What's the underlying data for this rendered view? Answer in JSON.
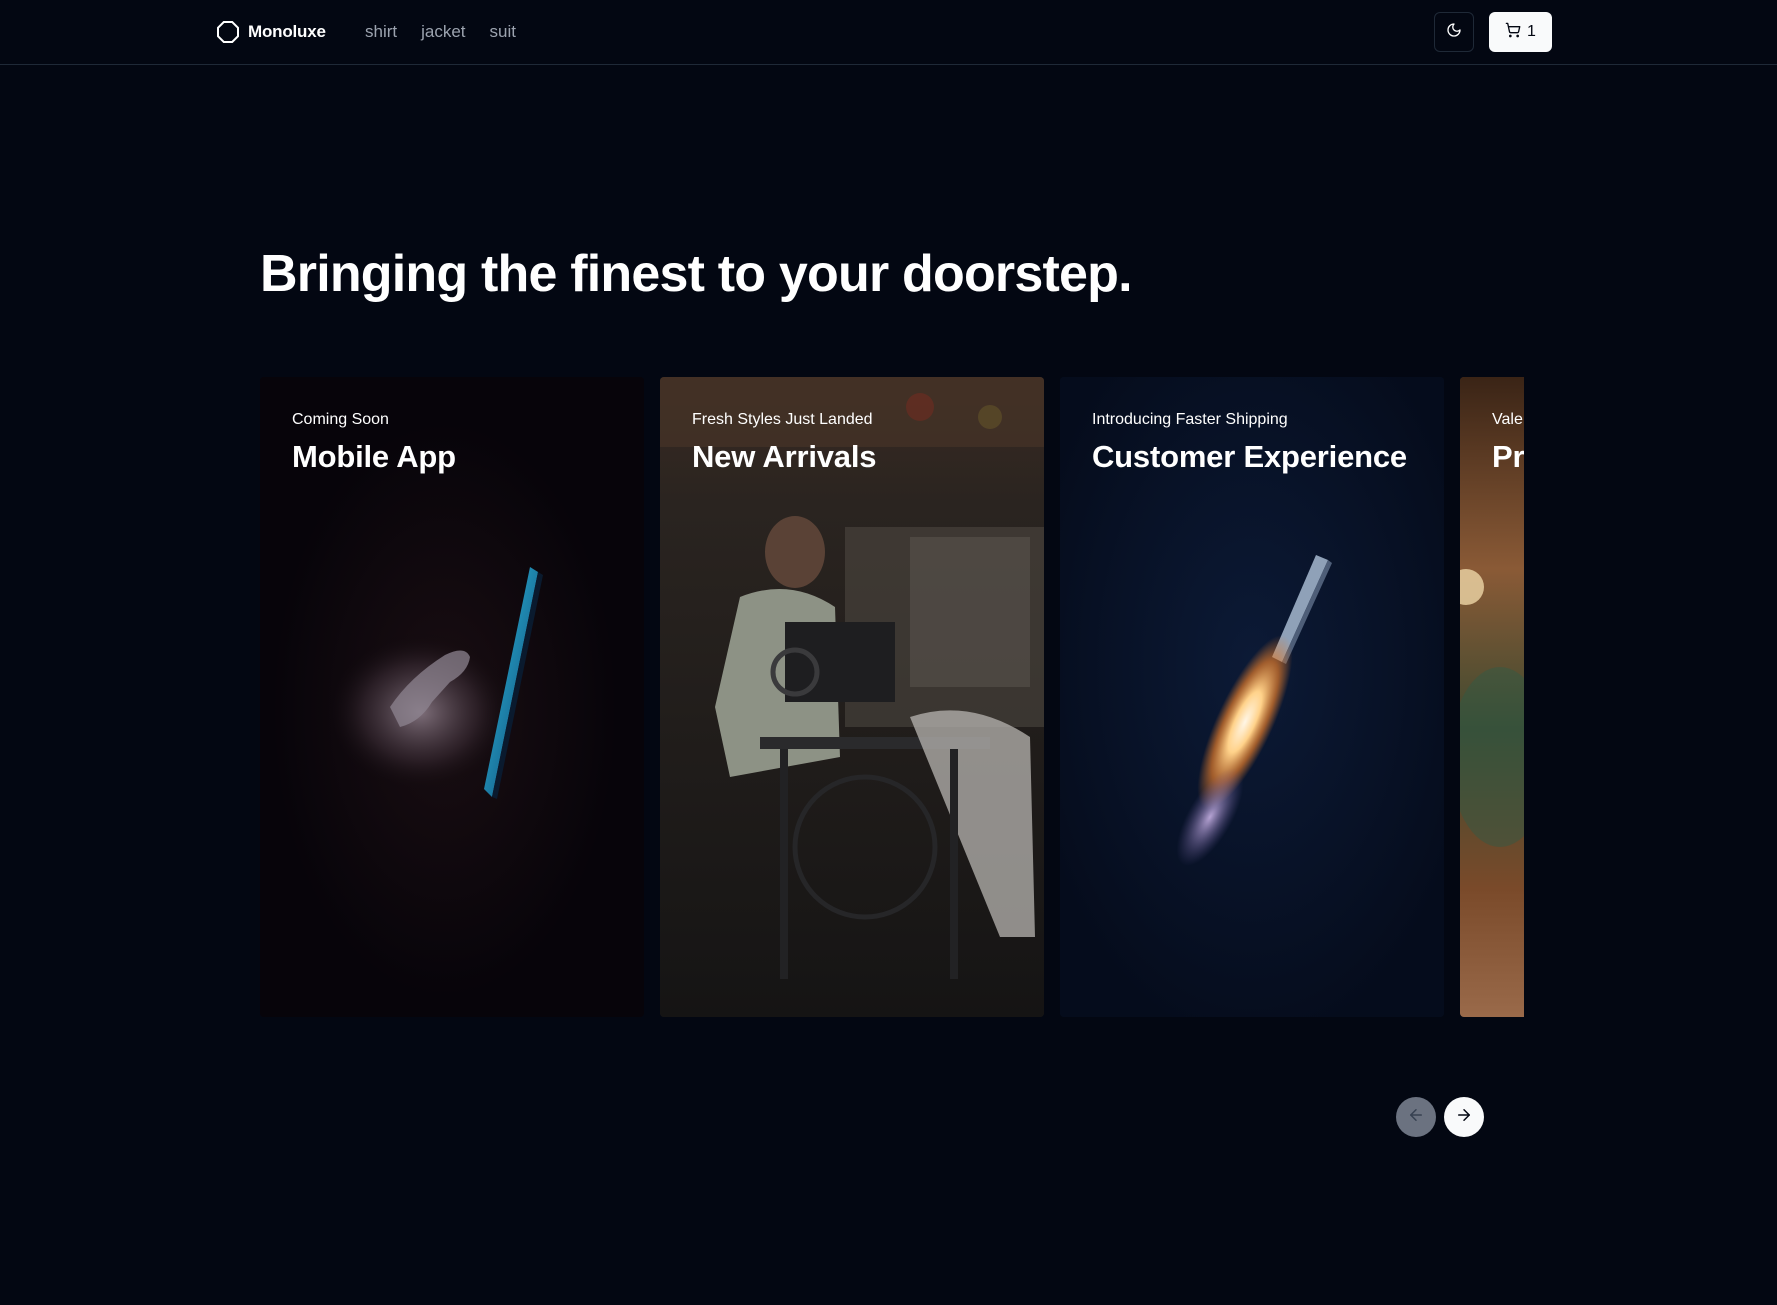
{
  "header": {
    "brand": "Monoluxe",
    "nav": [
      {
        "label": "shirt"
      },
      {
        "label": "jacket"
      },
      {
        "label": "suit"
      }
    ],
    "theme_icon": "moon-icon",
    "cart": {
      "icon": "cart-icon",
      "count": "1"
    }
  },
  "hero": {
    "title": "Bringing the finest to your doorstep."
  },
  "carousel": {
    "cards": [
      {
        "eyebrow": "Coming Soon",
        "title": "Mobile App",
        "image": "hand-holding-phone"
      },
      {
        "eyebrow": "Fresh Styles Just Landed",
        "title": "New Arrivals",
        "image": "tailor-at-sewing-machine"
      },
      {
        "eyebrow": "Introducing Faster Shipping",
        "title": "Customer Experience",
        "image": "rocket-launch"
      },
      {
        "eyebrow": "Vale",
        "title": "Pr",
        "image": "warm-abstract"
      }
    ],
    "prev_icon": "arrow-left-icon",
    "next_icon": "arrow-right-icon"
  },
  "colors": {
    "background": "#030712",
    "border": "#1f2937",
    "nav_text": "#9ca3af",
    "primary_button": "#f9fafb",
    "disabled_button": "#6b7280"
  }
}
